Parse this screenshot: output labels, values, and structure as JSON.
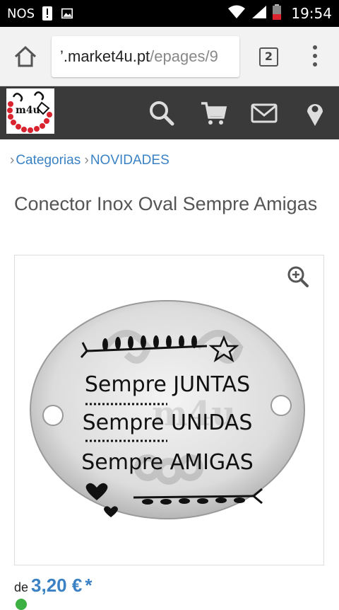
{
  "statusbar": {
    "carrier": "NOS",
    "time": "19:54",
    "icons": [
      "notification-icon",
      "image-icon",
      "wifi-icon",
      "signal-icon",
      "battery-icon"
    ]
  },
  "browser": {
    "url_domain": "’.market4u.pt",
    "url_path": "/epages/9",
    "tab_count": "2"
  },
  "header": {
    "logo_text": "m4u",
    "icons": [
      "search-icon",
      "cart-icon",
      "mail-icon",
      "location-icon"
    ]
  },
  "breadcrumb": {
    "items": [
      "Categorias",
      "NOVIDADES"
    ]
  },
  "product": {
    "title": "Conector Inox Oval Sempre Amigas",
    "image_lines": [
      "Sempre JUNTAS",
      "Sempre UNIDAS",
      "Sempre AMIGAS"
    ],
    "watermark": "m4u",
    "price_prefix": "de",
    "price": "3,20 €",
    "price_suffix": "*"
  },
  "colors": {
    "link": "#3a82c4",
    "header_bg": "#3a3a3a",
    "accent_red": "#d9232e"
  }
}
